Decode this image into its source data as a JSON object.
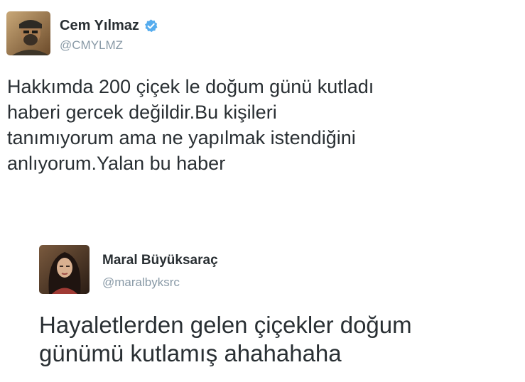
{
  "tweets": [
    {
      "display_name": "Cem Yılmaz",
      "handle": "@CMYLMZ",
      "verified": true,
      "avatar_icon": "avatar-photo-cem",
      "text_lines": [
        "Hakkımda 200 çiçek le doğum günü kutladı",
        "haberi gercek değildir.Bu kişileri",
        "tanımıyorum ama ne yapılmak istendiğini",
        "anlıyorum.Yalan bu haber"
      ]
    },
    {
      "display_name": "Maral Büyüksaraç",
      "handle": "@maralbyksrc",
      "verified": false,
      "avatar_icon": "avatar-photo-maral",
      "text_lines": [
        "Hayaletlerden gelen çiçekler doğum",
        "günümü kutlamış ahahahaha"
      ]
    }
  ],
  "colors": {
    "name": "#292f33",
    "handle": "#8899a6",
    "text": "#292f33",
    "verified_badge": "#55acee"
  }
}
